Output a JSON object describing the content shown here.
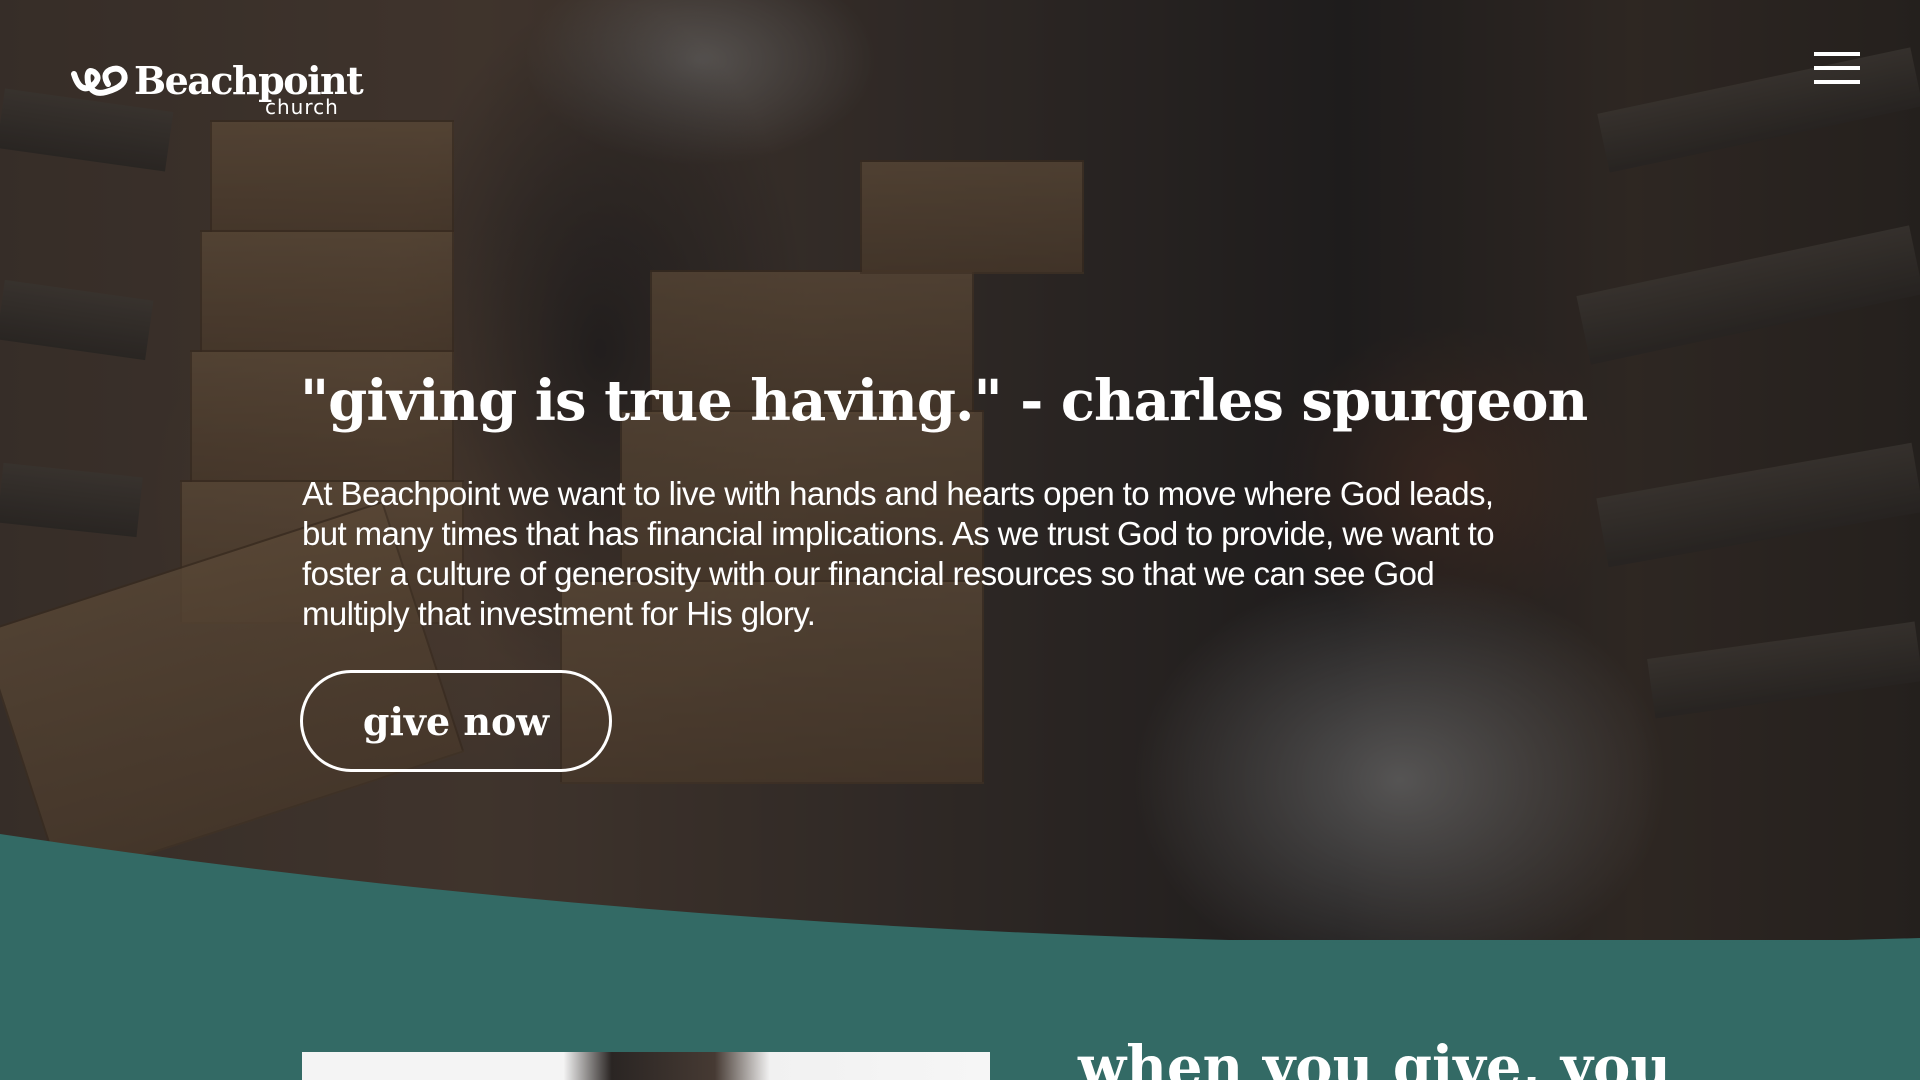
{
  "header": {
    "logo_text": "Beachpoint",
    "logo_subtext": "church",
    "menu_icon": "hamburger-menu-icon"
  },
  "hero": {
    "quote": "\"giving is true having.\" - charles spurgeon",
    "body": "At Beachpoint we want to live with hands and hearts open to move where God leads, but many times that has financial implications. As we trust God to provide, we want to foster a culture of generosity with our financial resources so that we can see God multiply that investment for His glory.",
    "cta_label": "give now"
  },
  "section": {
    "heading": "when you give, you"
  },
  "colors": {
    "accent": "#336a65",
    "text": "#ffffff"
  }
}
